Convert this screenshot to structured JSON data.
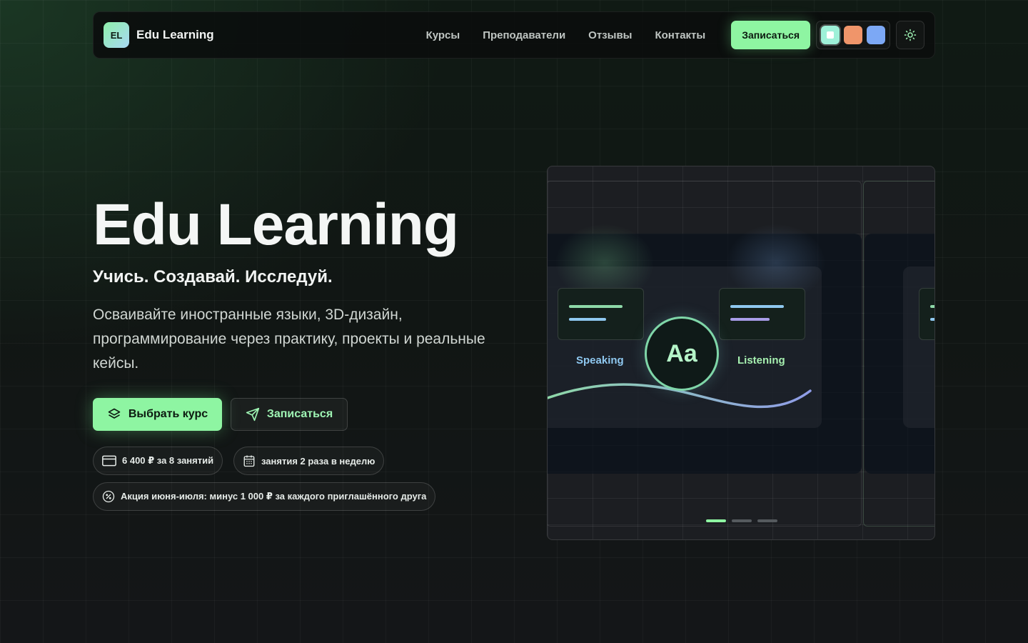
{
  "brand": {
    "badge": "EL",
    "name": "Edu Learning"
  },
  "nav": {
    "links": [
      "Курсы",
      "Преподаватели",
      "Отзывы",
      "Контакты"
    ],
    "cta": "Записаться",
    "theme_swatches": [
      {
        "name": "mint",
        "color": "#9ef0d8",
        "active": true
      },
      {
        "name": "orange",
        "color": "#f0956a",
        "active": false
      },
      {
        "name": "blue",
        "color": "#7ca8f5",
        "active": false
      }
    ],
    "theme_toggle_icon": "sun-icon"
  },
  "hero": {
    "title": "Edu Learning",
    "subtitle": "Учись. Создавай. Исследуй.",
    "description": "Осваивайте иностранные языки, 3D-дизайн, программирование через практику, проекты и реальные кейсы.",
    "primary_button": "Выбрать курс",
    "secondary_button": "Записаться",
    "chips": [
      {
        "icon": "credit-card-icon",
        "text": "6 400 ₽ за 8 занятий"
      },
      {
        "icon": "calendar-icon",
        "text": "занятия 2 раза в неделю"
      },
      {
        "icon": "discount-badge-icon",
        "text": "Акция июня-июля: минус 1 000 ₽ за каждого приглашённого друга"
      }
    ]
  },
  "showcase": {
    "center_glyph": "Aa",
    "left_label": "Speaking",
    "right_label": "Listening",
    "slides_total": 3,
    "active_slide": 1
  },
  "colors": {
    "accent": "#8ef5a2",
    "speaking": "#8fc8f0",
    "listening": "#a6f0b0"
  }
}
